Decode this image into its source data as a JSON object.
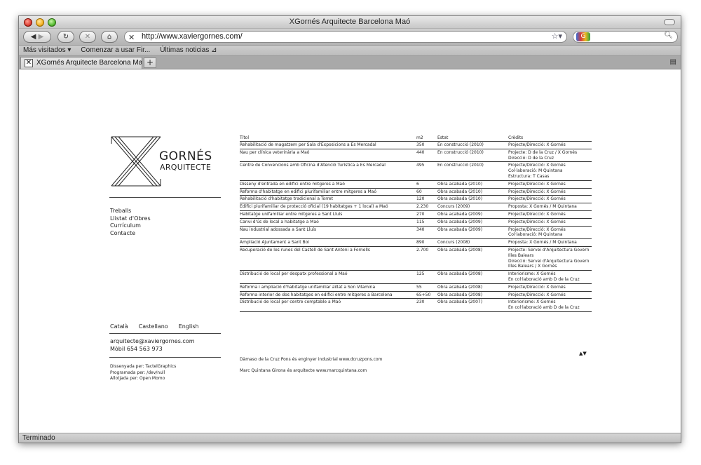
{
  "window": {
    "title": "XGornés Arquitecte Barcelona Maó"
  },
  "toolbar": {
    "url": "http://www.xaviergornes.com/"
  },
  "bookmarks": [
    "Más visitados ▾",
    "Comenzar a usar Fir...",
    "Últimas noticias ⊿"
  ],
  "tab": {
    "label": "XGornés Arquitecte Barcelona Ma...",
    "new_tab": "+"
  },
  "status": "Terminado",
  "site": {
    "logo": {
      "line1": "GORNÉS",
      "line2": "ARQUITECTE"
    },
    "menu": [
      "Treballs",
      "Llistat d'Obres",
      "Currículum",
      "Contacte"
    ],
    "languages": [
      "Català",
      "Castellano",
      "English"
    ],
    "email": "arquitecte@xaviergornes.com",
    "phone": "Mòbil 654 563 973",
    "credits": [
      "Dissenyada per: TactelGraphics",
      "Programada per: /dev/null",
      "Allotjada per: Open Momo"
    ],
    "table": {
      "headers": [
        "Títol",
        "m2",
        "Estat",
        "Crèdits"
      ],
      "rows": [
        [
          "Rehabilitació de magatzem per Sala d'Exposicions a Es Mercadal",
          "350",
          "En construcció (2010)",
          "Projecte/Direcció: X Gornés"
        ],
        [
          "Nau per clínica veterinària a Maó",
          "440",
          "En construcció (2010)",
          "Projecte: D de la Cruz / X Gornés\nDirecció: D de la Cruz"
        ],
        [
          "Centre de Convencions amb Oficina d'Atenció Turística a Es Mercadal",
          "495",
          "En construcció (2010)",
          "Projecte/Direcció: X Gornés\nCol·laboració: M Quintana\nEstructura: T Casas"
        ],
        [
          "Disseny d'entrada en edifici entre mitgeres a Maó",
          "6",
          "Obra acabada (2010)",
          "Projecte/Direcció: X Gornés"
        ],
        [
          "Reforma d'habitatge en edifici plurifamiliar entre mitgeres a Maó",
          "60",
          "Obra acabada (2010)",
          "Projecte/Direcció: X Gornés"
        ],
        [
          "Rehabilitació d'habitatge tradicional a Torret",
          "120",
          "Obra acabada (2010)",
          "Projecte/Direcció: X Gornés"
        ],
        [
          "Edifici plurifamiliar de protecció oficial (19 habitatges + 1 local) a Maó",
          "2.230",
          "Concurs (2009)",
          "Proposta: X Gornés / M Quintana"
        ],
        [
          "Habitatge unifamiliar entre mitgeres a Sant Lluís",
          "270",
          "Obra acabada (2009)",
          "Projecte/Direcció: X Gornés"
        ],
        [
          "Canvi d'ús de local a habitatge a Maó",
          "115",
          "Obra acabada (2009)",
          "Projecte/Direcció: X Gornés"
        ],
        [
          "Nau industrial adossada a Sant Lluís",
          "340",
          "Obra acabada (2009)",
          "Projecte/Direcció: X Gornés\nCol·laboració: M Quintana"
        ],
        [
          "Ampliació Ajuntament a Sant Boi",
          "890",
          "Concurs (2008)",
          "Proposta: X Gornés / M Quintana"
        ],
        [
          "Recuperació de les runes del Castell de Sant Antoni a Fornells",
          "2.700",
          "Obra acabada (2008)",
          "Projecte: Servei d'Arquitectura Govern Illes Balears\nDirecció: Servei d'Arquitectura Govern Illes Balears / X Gornés"
        ],
        [
          "Distribució de local per despatx professional a Maó",
          "125",
          "Obra acabada (2008)",
          "Interiorisme: X Gornés\nEn col·laboració amb D de la Cruz"
        ],
        [
          "Reforma i ampliació d'habitatge unifamiliar aïllat a Son Vilamina",
          "55",
          "Obra acabada (2008)",
          "Projecte/Direcció: X Gornés"
        ],
        [
          "Reforma interior de dos habitatges en edifici entre mitgeres a Barcelona",
          "65+50",
          "Obra acabada (2008)",
          "Projecte/Direcció: X Gornés"
        ],
        [
          "Distribució de local per centre comptable a Maó",
          "230",
          "Obra acabada (2007)",
          "Interiorisme: X Gornés\nEn col·laboració amb D de la Cruz"
        ]
      ]
    },
    "sort_arrows": "▲▼",
    "footer1": "Dàmaso de la Cruz Pons és enginyer industrial   www.dcruzpons.com",
    "footer2": "Marc Quintana Girona és arquitecte   www.marcquintana.com"
  }
}
